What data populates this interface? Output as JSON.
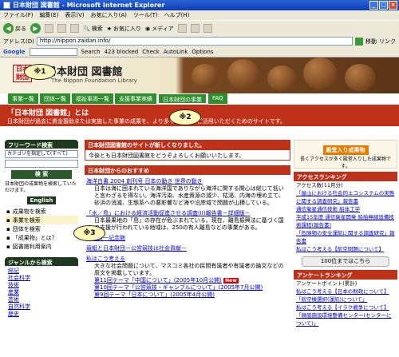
{
  "window": {
    "title": "日本財団 図書館 - Microsoft Internet Explorer"
  },
  "menu": [
    "ファイル(F)",
    "編集(E)",
    "表示(V)",
    "お気に入り(A)",
    "ツール(T)",
    "ヘルプ(H)"
  ],
  "toolbar": {
    "back": "戻る",
    "search": "検索",
    "favorites": "お気に入り",
    "media": "メディア"
  },
  "address": {
    "label": "アドレス(D)",
    "url": "http://nippon.zaidan.info/",
    "go": "移動",
    "links": "リンク"
  },
  "google": {
    "logo": "Google",
    "search": "Search",
    "blocked": "423 blocked",
    "check": "Check",
    "autolink": "AutoLink",
    "options": "Options"
  },
  "header": {
    "logo": "日本財団",
    "title": "日本財団 図書館",
    "subtitle": "The Nippon Foundation Library"
  },
  "nav": [
    "事業一覧",
    "団体一覧",
    "福祉車両一覧",
    "支援事業実績",
    "日本財団の事業",
    "FAQ"
  ],
  "banner": {
    "title": "「日本財団 図書館」とは",
    "text": "日本財団が過去に資金援助または実施した事業の成果を、より多くの人々にご活用いただくためのサイトです。"
  },
  "left": {
    "freeword": "フリーワード検索",
    "category": "カテゴリを指定して(すべて)",
    "search_btn": "検 索",
    "help": "日本財団の成果物を検索していただけます。",
    "english": "English",
    "links": [
      "成果物を検索",
      "事業を検索",
      "団体を検索",
      "「成果物」とは？",
      "図書館利用案内"
    ],
    "genre": "ジャンルから検索",
    "genres": [
      "総記",
      "社会科学",
      "技術",
      "産業",
      "芸術",
      "自然科学",
      "歴史"
    ]
  },
  "main": {
    "notice_head": "日本財団図書館のサイトが新しくなりました。",
    "notice": "今後とも日本財団図書館をどうぞよろしくお願いいたします。",
    "rec_head": "日本財団からのおすすめ",
    "items": [
      {
        "title": "海洋白書 2004 創刊号 日本の動き 世界の動き",
        "desc": "日本は海に囲まれている海洋国でありながら海洋に関する関心は総じて低いと言わざるを得ない。海洋汚染、水産資源の減少、枯渇、内海の埋め立て、砂浜の消滅、生態系への悪影響など海や沿岸域で問題が山積している。"
      },
      {
        "title": "「水／島」における経済活動促進させる調査(II)報告書－詳細版－",
        "desc": "日本最果地の「島」の存在が危ぶまれている。現在、離島振興法に基づく国の支援が行われている地域は、250の有人離島などの事業がある。"
      },
      {
        "title": "笹川良一記念館",
        "desc": ""
      },
      {
        "title": "競艇と日本財団－公営競技は社会貢献－",
        "desc": ""
      },
      {
        "title": "私はこう考える",
        "desc": "大きな社会問題について、マスコミ各社の民間有識者や有識者の論文などの原文を掲載しています。"
      }
    ],
    "topics": [
      {
        "text": "第11回テーマ「中国について」(2005年10月公開)",
        "new": "New"
      },
      {
        "text": "第10回テーマ「公営競技・ギャンブルについて」(2005年7月公開)",
        "new": ""
      },
      {
        "text": "第9回テーマ「日本について」(2005年4月公開)",
        "new": ""
      }
    ]
  },
  "right": {
    "popular": "殿堂入り成果物",
    "popular_sub": "長くアクセスが多く殿堂入りした成果物です。",
    "ranking": "アクセスランキング",
    "ranking_sub": "アクセス数(11月分)",
    "rank": [
      "「屋山における社会的エコシステムの実態に関する調査研究」報告書",
      "通信衛星通信技術 船体工学",
      "平成15年度 通信衛星開発 船舶無線設備技術課程(報告書)",
      "「危険物の安全運航に関する調査研究」報告書",
      "私はこう考える【航空問題について】"
    ],
    "top100": "100位まではこちら",
    "survey": "アンケートランキング",
    "survey_sub": "アンケートポイント(累計)",
    "survey_items": [
      "私はこう考える【日本の財政について】",
      "「航空機選択(運航)について」",
      "私はこう考える【イラク戦争について】",
      "「競艇施設環境整備センター(センターについて)」"
    ]
  },
  "callouts": [
    "※1",
    "※2",
    "※3"
  ]
}
